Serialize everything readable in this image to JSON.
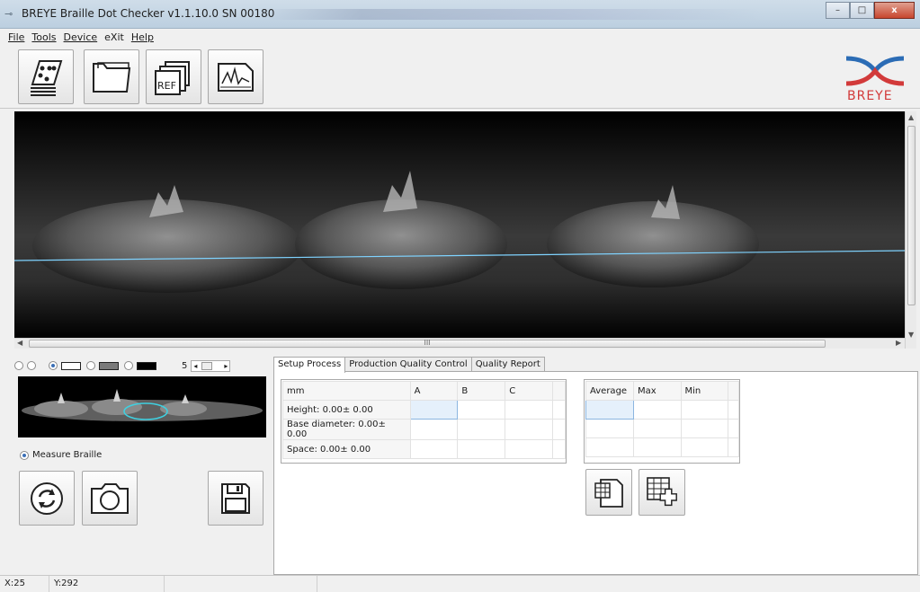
{
  "window": {
    "title": "BREYE Braille Dot Checker v1.1.10.0 SN 00180",
    "minimize": "–",
    "maximize": "□",
    "close": "x"
  },
  "menu": [
    "File",
    "Tools",
    "Device",
    "eXit",
    "Help"
  ],
  "toolbar": {
    "ref_label": "REF",
    "logo_text": "BREYE"
  },
  "viewer": {
    "hscroll_label": "III"
  },
  "left": {
    "zoom_value": "5",
    "measure_label": "Measure Braille"
  },
  "tabs": [
    "Setup Process",
    "Production Quality Control",
    "Quality Report"
  ],
  "measure_table": {
    "headers": [
      "mm",
      "A",
      "B",
      "C",
      ""
    ],
    "rows": [
      "Height: 0.00± 0.00",
      "Base diameter: 0.00± 0.00",
      "Space: 0.00± 0.00"
    ]
  },
  "stats_table": {
    "headers": [
      "Average",
      "Max",
      "Min",
      ""
    ]
  },
  "status": {
    "x": "X:25",
    "y": "Y:292"
  },
  "colors": {
    "logo_blue": "#2b6cb5",
    "logo_red": "#d23a3a",
    "scan_line": "#7fd3ff",
    "ellipse": "#3fd0e0"
  }
}
